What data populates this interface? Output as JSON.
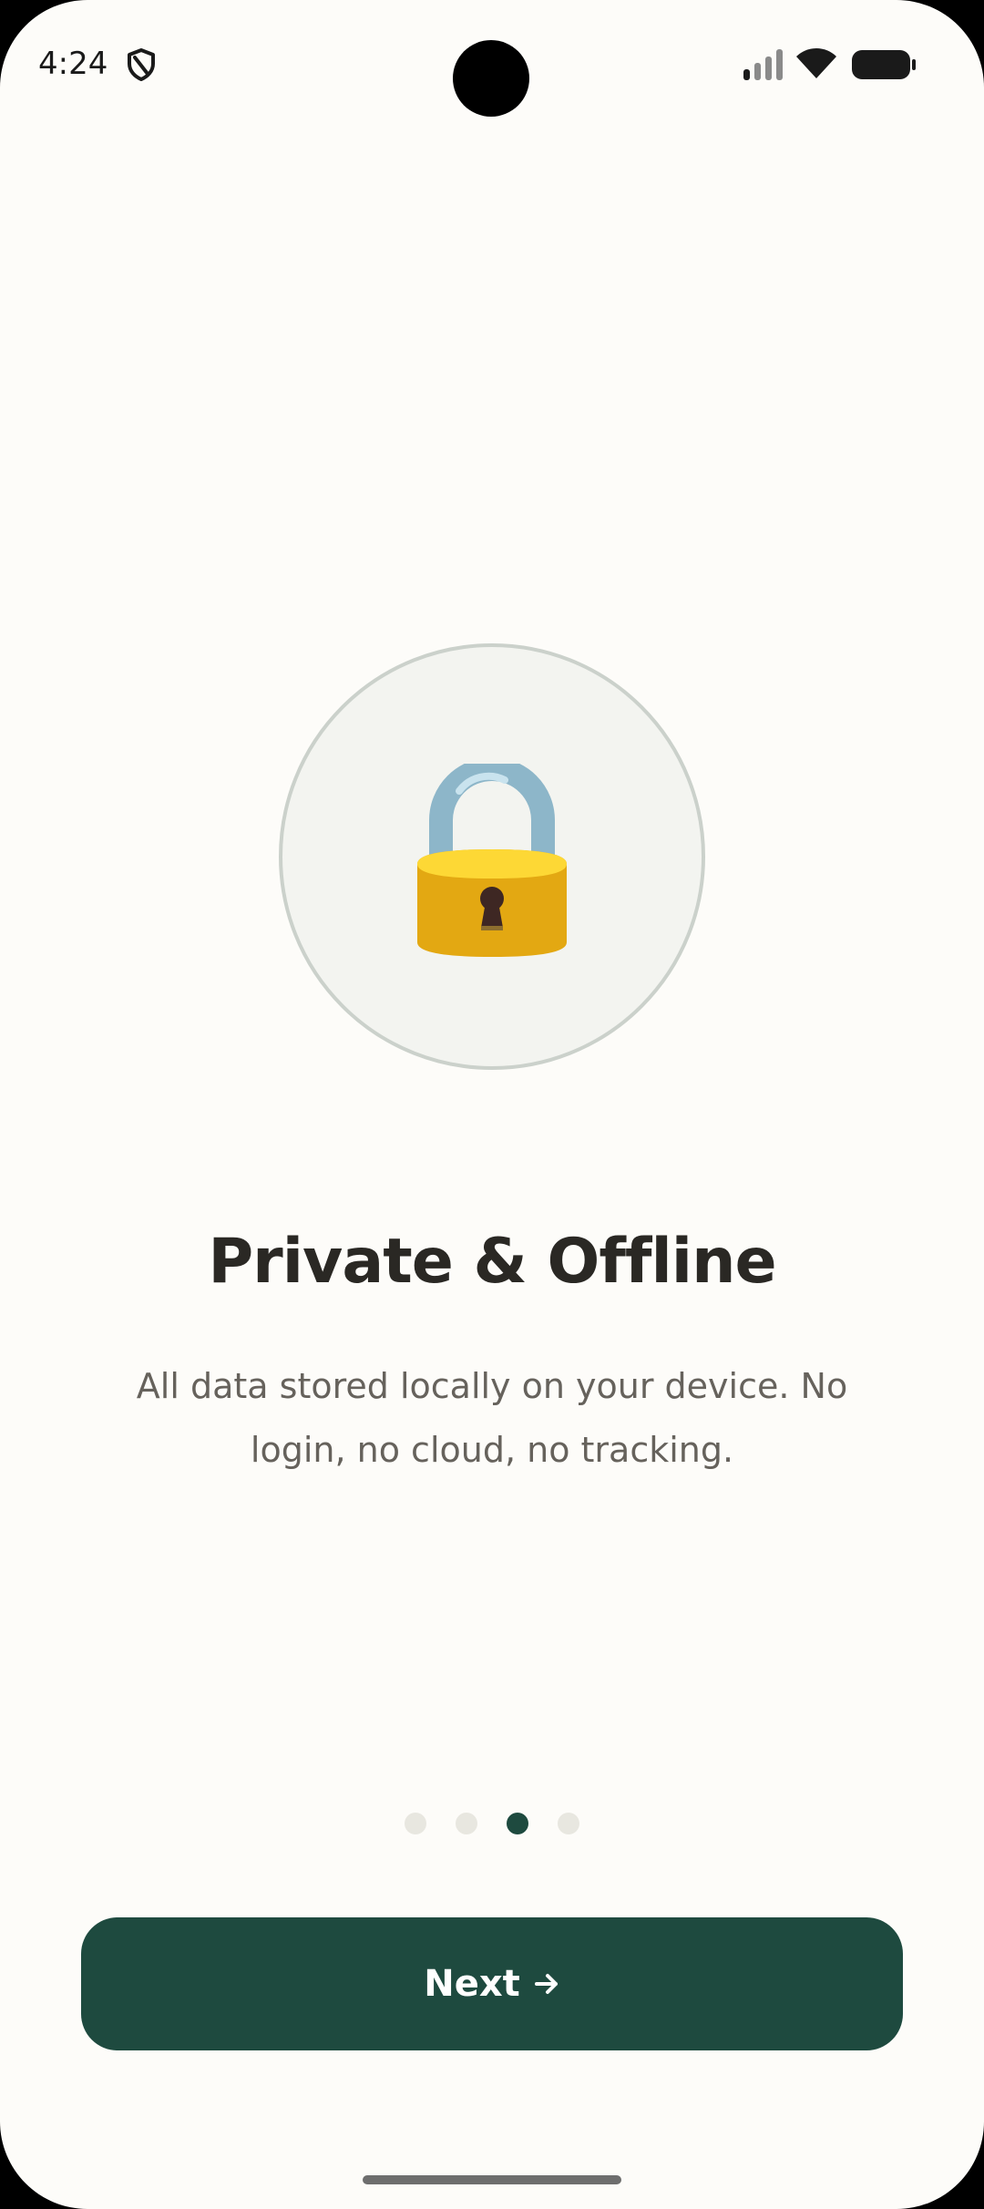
{
  "status_bar": {
    "time": "4:24",
    "icons": [
      "shield-icon",
      "cellular-signal-icon",
      "wifi-icon",
      "battery-icon"
    ]
  },
  "onboarding": {
    "illustration_icon": "padlock-icon",
    "title": "Private & Offline",
    "description": "All data stored locally on your device. No login, no cloud, no tracking.",
    "page_count": 4,
    "current_page": 3
  },
  "actions": {
    "next_label": "Next",
    "next_icon": "arrow-right-icon"
  },
  "colors": {
    "background": "#FDFCF9",
    "primary": "#1E4A3F",
    "dot_inactive": "#E8E7E0",
    "title": "#2A2824",
    "body_text": "#66625C"
  }
}
